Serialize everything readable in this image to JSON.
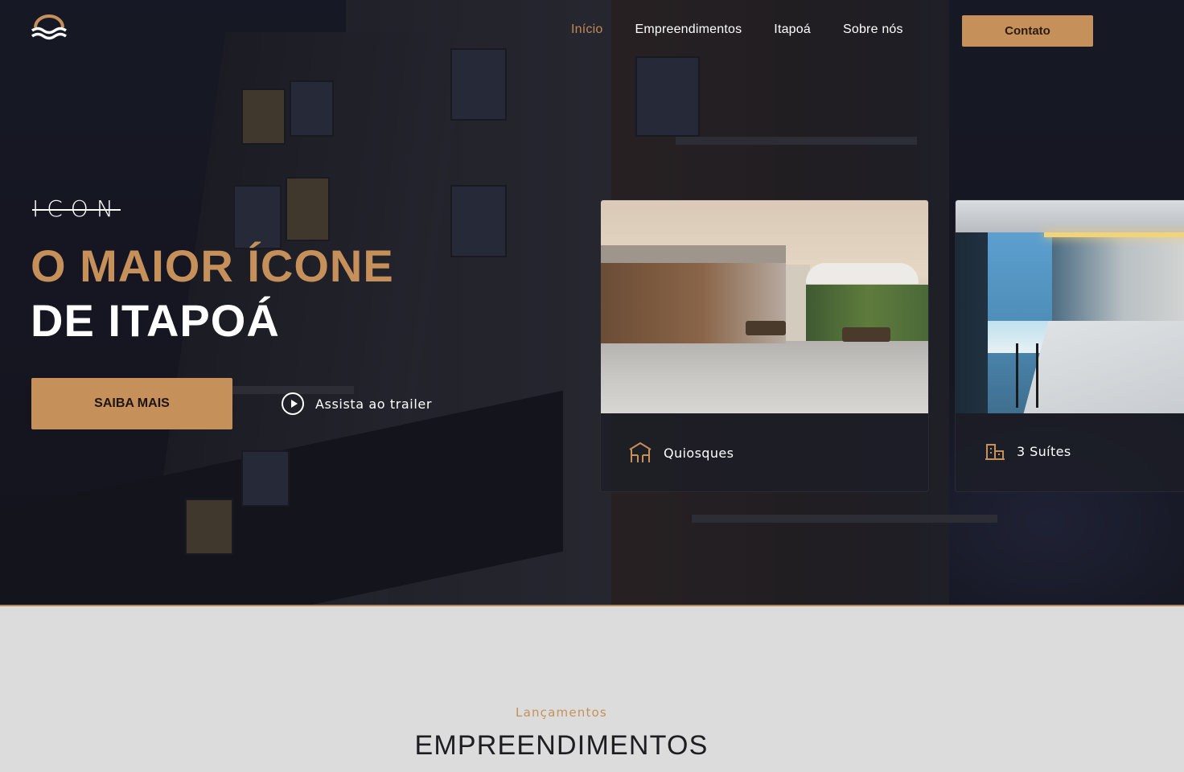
{
  "header": {
    "nav": [
      {
        "label": "Início",
        "active": true
      },
      {
        "label": "Empreendimentos",
        "active": false
      },
      {
        "label": "Itapoá",
        "active": false
      },
      {
        "label": "Sobre nós",
        "active": false
      }
    ],
    "contact_label": "Contato"
  },
  "hero": {
    "brand": "ICON",
    "title_line1": "O MAIOR ÍCONE",
    "title_line2": "DE ITAPOÁ",
    "cta_label": "SAIBA MAIS",
    "trailer_label": "Assista ao trailer"
  },
  "features": [
    {
      "label": "Quiosques",
      "icon": "kiosk-icon"
    },
    {
      "label": "3 Suítes",
      "icon": "building-icon"
    }
  ],
  "section": {
    "kicker": "Lançamentos",
    "title": "EMPREENDIMENTOS"
  },
  "colors": {
    "accent": "#c6905b",
    "hero_bg": "#1d2030",
    "section_bg": "#dcdcdc"
  }
}
